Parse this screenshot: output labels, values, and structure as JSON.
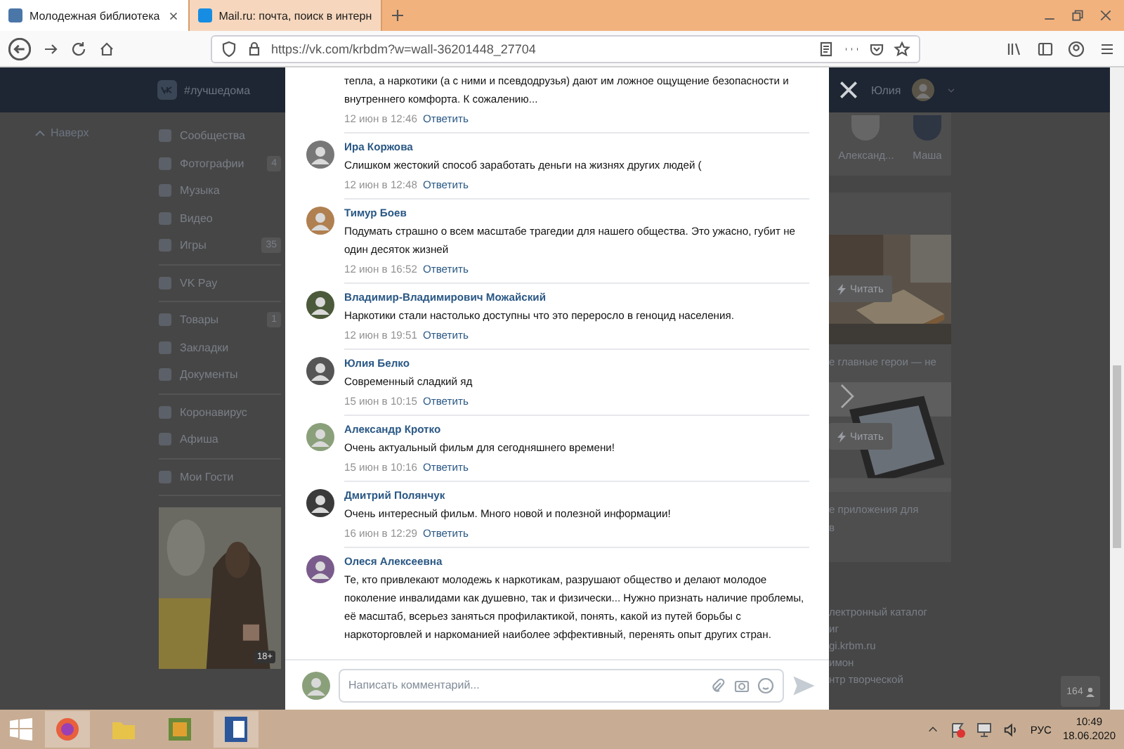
{
  "browser": {
    "tabs": [
      {
        "title": "Молодежная библиотека",
        "selected": true
      },
      {
        "title": "Mail.ru: почта, поиск в интерн",
        "selected": false
      }
    ],
    "address": "https://vk.com/krbdm?w=wall-36201448_27704"
  },
  "vk_header": {
    "hashtag": "#лучшедома",
    "user_name": "Юлия"
  },
  "back_to_top": "Наверх",
  "sidebar": {
    "groups": [
      [
        {
          "label": "Сообщества"
        },
        {
          "label": "Фотографии",
          "count": "4"
        },
        {
          "label": "Музыка"
        },
        {
          "label": "Видео"
        },
        {
          "label": "Игры",
          "count": "35"
        }
      ],
      [
        {
          "label": "VK Pay"
        }
      ],
      [
        {
          "label": "Товары",
          "count": "1"
        },
        {
          "label": "Закладки"
        },
        {
          "label": "Документы"
        }
      ],
      [
        {
          "label": "Коронавирус"
        },
        {
          "label": "Афиша"
        }
      ],
      [
        {
          "label": "Мои Гости"
        }
      ]
    ],
    "promo": {
      "kind": "picture",
      "badge": "18+"
    }
  },
  "comments": [
    {
      "text": "тепла, а наркотики (а с ними и псевдодрузья) дают им ложное ощущение безопасности и внутреннего комфорта. К сожалению...",
      "date": "12 июн в 12:46",
      "reply": "Ответить"
    },
    {
      "author": "Ира Коржова",
      "text": "Слишком жестокий способ заработать деньги на жизнях других людей (",
      "date": "12 июн в 12:48",
      "reply": "Ответить"
    },
    {
      "author": "Тимур Боев",
      "text": "Подумать страшно о всем масштабе трагедии для нашего общества. Это ужасно, губит не один десяток жизней",
      "date": "12 июн в 16:52",
      "reply": "Ответить"
    },
    {
      "author": "Владимир-Владимирович Можайский",
      "text": "Наркотики стали настолько доступны что это переросло в геноцид населения.",
      "date": "12 июн в 19:51",
      "reply": "Ответить"
    },
    {
      "author": "Юлия Белко",
      "text": "Современный сладкий яд",
      "date": "15 июн в 10:15",
      "reply": "Ответить"
    },
    {
      "author": "Александр Кротко",
      "text": "Очень актуальный фильм для сегодняшнего времени!",
      "date": "15 июн в 10:16",
      "reply": "Ответить"
    },
    {
      "author": "Дмитрий Полянчук",
      "text": "Очень интересный фильм. Много новой и полезной информации!",
      "date": "16 июн в 12:29",
      "reply": "Ответить"
    },
    {
      "author": "Олеся Алексеевна",
      "text": "Те, кто привлекают молодежь к наркотикам, разрушают общество и делают молодое поколение инвалидами как душевно, так и физически... Нужно признать наличие проблемы, её масштаб, всерьез заняться профилактикой, понять, какой из путей борьбы с наркоторговлей и наркоманией наиболее эффективный, перенять опыт других стран."
    }
  ],
  "comment_input": {
    "placeholder": "Написать комментарий..."
  },
  "right": {
    "friends": [
      "Александ...",
      "Маша"
    ],
    "cards": [
      {
        "button": "Читать",
        "caption": [
          "е главные герои — не"
        ]
      },
      {
        "button": "Читать",
        "caption": [
          "е приложения для",
          "в"
        ]
      }
    ],
    "links": [
      "лектронный каталог",
      "иг",
      "gi.krbm.ru",
      "имон",
      "нтр творческой"
    ],
    "online_count": "164"
  },
  "taskbar": {
    "language": "РУС",
    "time": "10:49",
    "date": "18.06.2020"
  }
}
